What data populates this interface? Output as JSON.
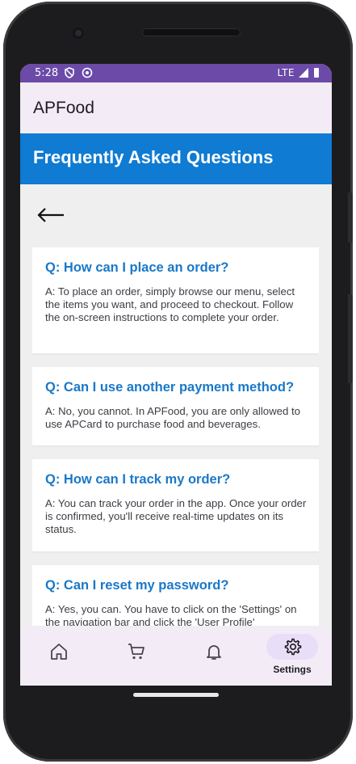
{
  "status_bar": {
    "time": "5:28",
    "network": "LTE"
  },
  "app_bar": {
    "title": "APFood"
  },
  "faq_header": {
    "title": "Frequently Asked Questions"
  },
  "faqs": [
    {
      "question": "Q: How can I place an order?",
      "answer": "A: To place an order, simply browse our menu, select the items you want, and proceed to checkout. Follow the on-screen instructions to complete your order."
    },
    {
      "question": "Q: Can I use another payment method?",
      "answer": "A: No, you cannot. In APFood, you are only allowed to use APCard to purchase food and beverages."
    },
    {
      "question": "Q: How can I track my order?",
      "answer": "A: You can track your order in the app. Once your order is confirmed, you'll receive real-time updates on its status."
    },
    {
      "question": "Q: Can I reset my password?",
      "answer": "A: Yes, you can. You have to click on the 'Settings' on the navigation bar and click the 'User Profile'"
    }
  ],
  "bottom_nav": {
    "items": [
      {
        "icon": "home-icon",
        "label": ""
      },
      {
        "icon": "cart-icon",
        "label": ""
      },
      {
        "icon": "bell-icon",
        "label": ""
      },
      {
        "icon": "gear-icon",
        "label": "Settings"
      }
    ],
    "active": "Settings"
  },
  "colors": {
    "status_bar": "#6b4aa8",
    "app_bar": "#f3ecf7",
    "faq_header": "#0f7bd2",
    "question_text": "#1a78c9",
    "nav_active_pill": "#e8def8"
  }
}
